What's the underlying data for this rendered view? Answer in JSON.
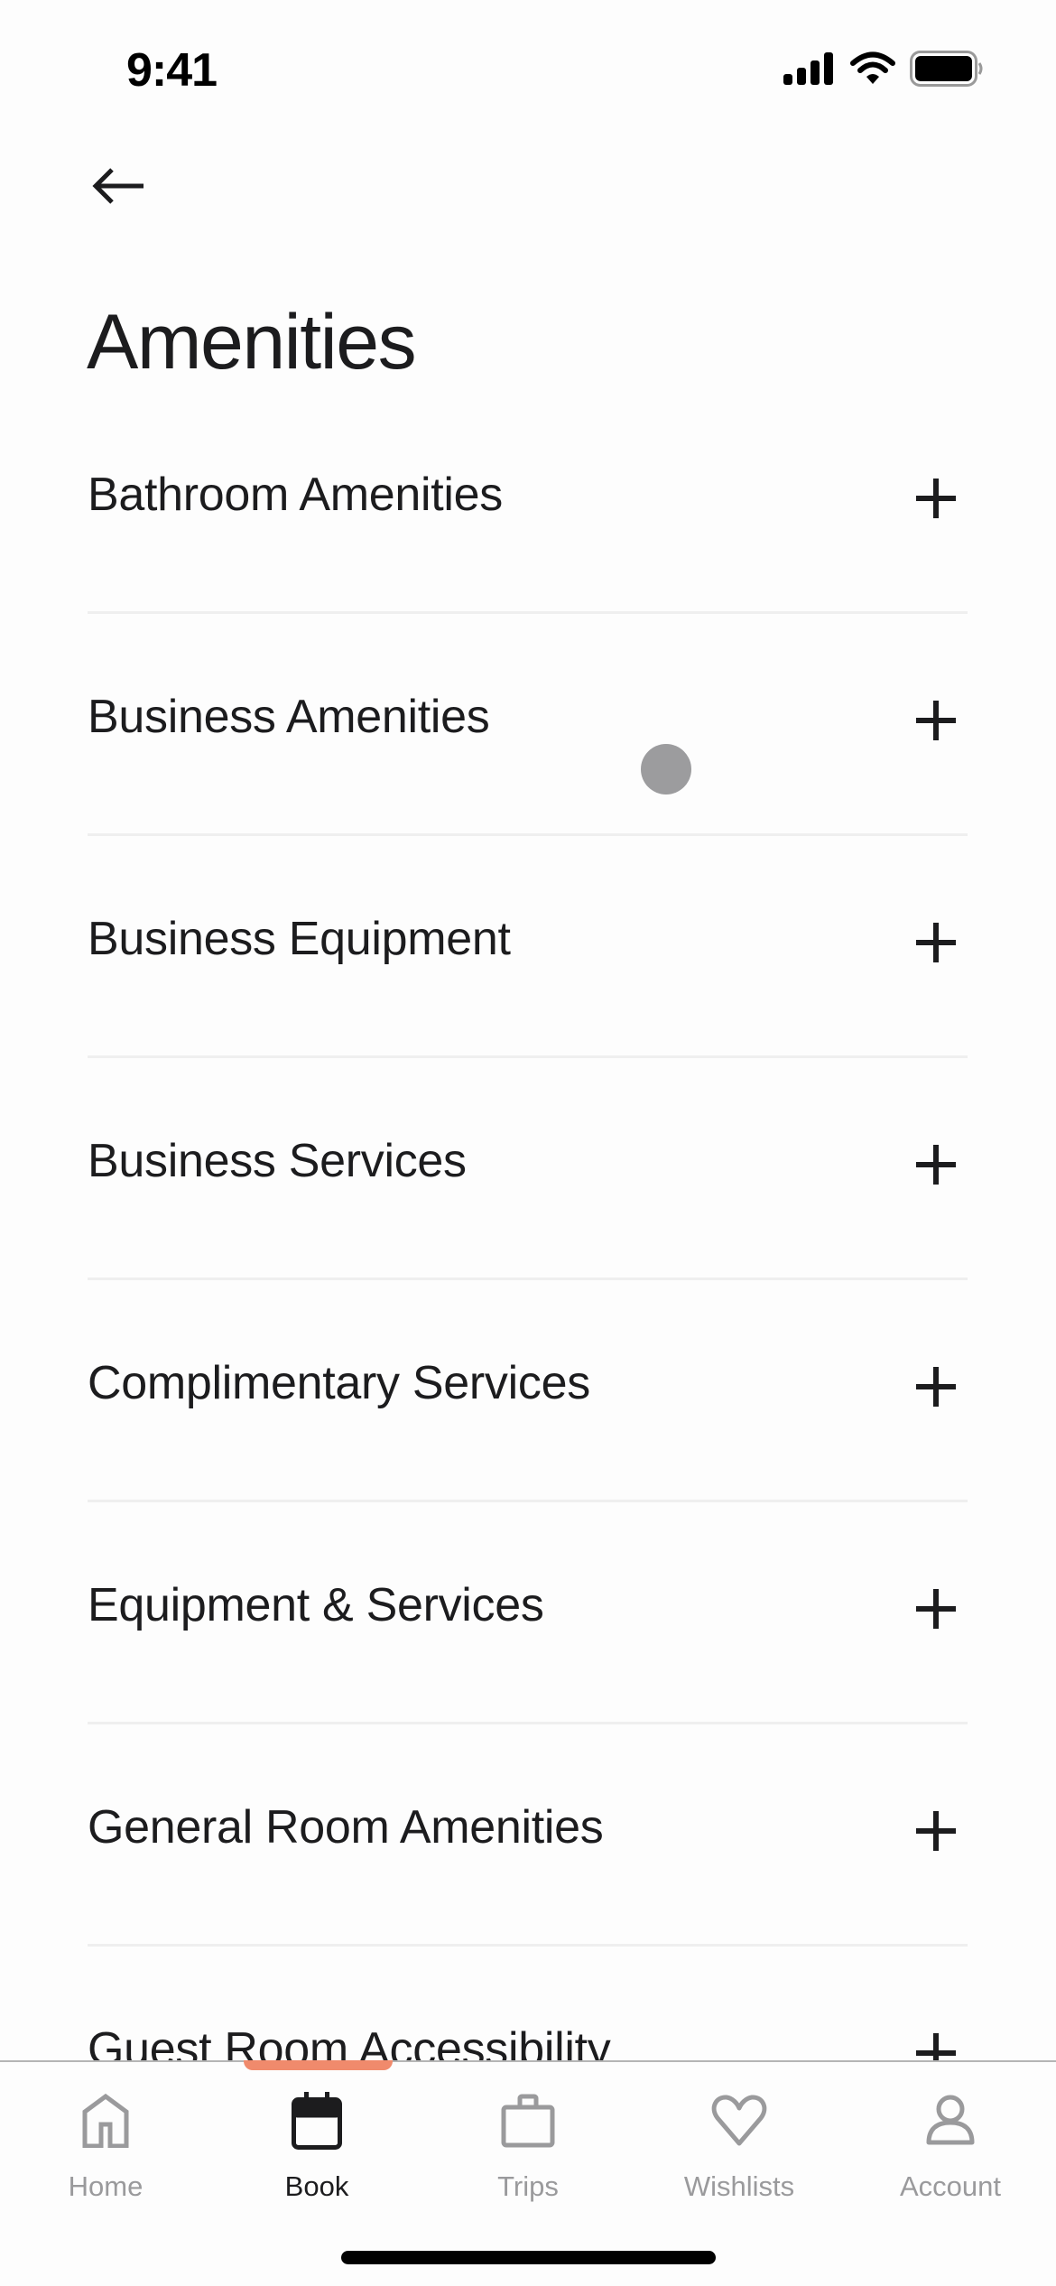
{
  "status_bar": {
    "time": "9:41",
    "icons": [
      "cellular-signal-icon",
      "wifi-icon",
      "battery-icon"
    ]
  },
  "header": {
    "back_icon": "arrow-left-icon",
    "title": "Amenities"
  },
  "amenity_categories": [
    {
      "label": "Bathroom Amenities",
      "action_icon": "plus-icon"
    },
    {
      "label": "Business Amenities",
      "action_icon": "plus-icon"
    },
    {
      "label": "Business Equipment",
      "action_icon": "plus-icon"
    },
    {
      "label": "Business Services",
      "action_icon": "plus-icon"
    },
    {
      "label": "Complimentary Services",
      "action_icon": "plus-icon"
    },
    {
      "label": "Equipment & Services",
      "action_icon": "plus-icon"
    },
    {
      "label": "General Room Amenities",
      "action_icon": "plus-icon"
    },
    {
      "label": "Guest Room Accessibility",
      "action_icon": "plus-icon"
    }
  ],
  "tab_bar": {
    "active_index": 1,
    "tabs": [
      {
        "label": "Home",
        "icon": "home-icon"
      },
      {
        "label": "Book",
        "icon": "calendar-icon"
      },
      {
        "label": "Trips",
        "icon": "suitcase-icon"
      },
      {
        "label": "Wishlists",
        "icon": "heart-icon"
      },
      {
        "label": "Account",
        "icon": "person-icon"
      }
    ]
  },
  "colors": {
    "accent": "#f08a6c",
    "text_primary": "#1c1c1e",
    "text_inactive": "#9a9a9c",
    "divider": "#efefef",
    "background": "#fdfdfd"
  }
}
